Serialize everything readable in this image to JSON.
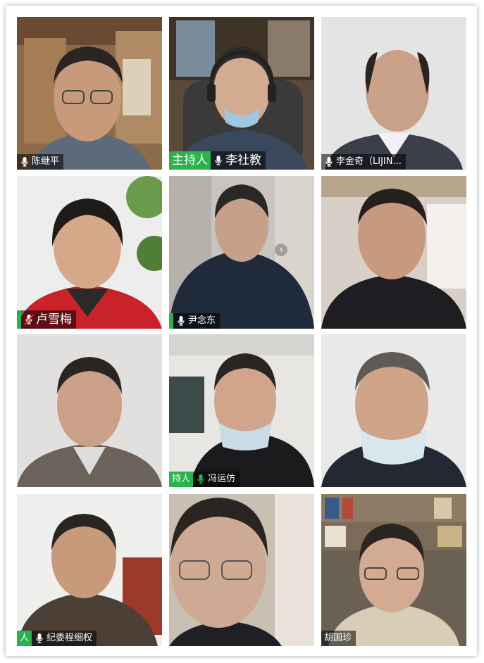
{
  "meeting": {
    "participants": [
      {
        "name": "陈继平",
        "host": false,
        "mic": "on"
      },
      {
        "name": "李社教",
        "host": true,
        "host_label": "主持人",
        "mic": "on"
      },
      {
        "name": "李金奇（LIJIN...",
        "host": false,
        "mic": "on"
      },
      {
        "name": "卢雪梅",
        "host": false,
        "mic": "muted"
      },
      {
        "name": "尹念东",
        "host": false,
        "mic": "on"
      },
      {
        "name": "",
        "host": false,
        "mic": "none"
      },
      {
        "name": "",
        "host": false,
        "mic": "none"
      },
      {
        "name": "冯运仿",
        "host": true,
        "host_label": "持人",
        "mic": "on"
      },
      {
        "name": "",
        "host": false,
        "mic": "none"
      },
      {
        "name": "纪委程细权",
        "host": true,
        "host_label": "人",
        "mic": "on"
      },
      {
        "name": "",
        "host": false,
        "mic": "none"
      },
      {
        "name": "胡国珍",
        "host": false,
        "mic": "none"
      }
    ]
  },
  "icons": {
    "mic": "microphone-icon",
    "mic_muted": "microphone-muted-icon",
    "next": "chevron-right-icon"
  },
  "colors": {
    "host_badge": "#2bb24c",
    "tag_bg": "rgba(0,0,0,0.55)",
    "mute_red": "#e53935"
  }
}
